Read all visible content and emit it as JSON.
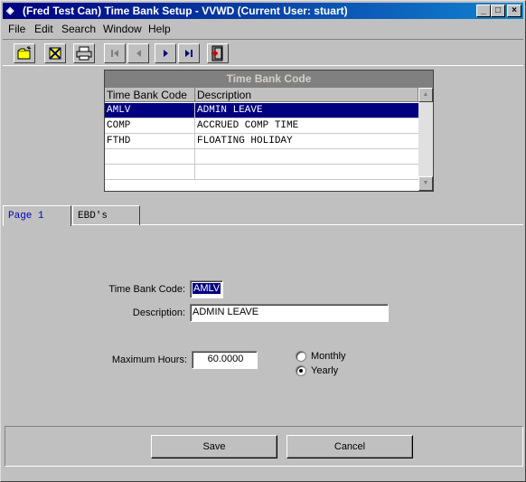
{
  "window": {
    "title": "(Fred Test Can) Time Bank Setup - VVWD (Current User: stuart)"
  },
  "menu": [
    "File",
    "Edit",
    "Search",
    "Window",
    "Help"
  ],
  "toolbar_icons": [
    "new-record-icon",
    "delete-record-icon",
    "print-icon",
    "first-record-icon",
    "previous-record-icon",
    "next-record-icon",
    "last-record-icon",
    "exit-icon"
  ],
  "grid": {
    "caption": "Time Bank Code",
    "columns": [
      "Time Bank Code",
      "Description"
    ],
    "rows": [
      {
        "code": "AMLV",
        "description": "ADMIN LEAVE"
      },
      {
        "code": "COMP",
        "description": "ACCRUED COMP TIME"
      },
      {
        "code": "FTHD",
        "description": "FLOATING HOLIDAY"
      }
    ]
  },
  "tabs": [
    "Page 1",
    "EBD's"
  ],
  "form": {
    "time_bank_code_label": "Time Bank Code:",
    "time_bank_code_value": "AMLV",
    "description_label": "Description:",
    "description_value": "ADMIN LEAVE",
    "max_hours_label": "Maximum Hours:",
    "max_hours_value": "60.0000",
    "period_options": [
      "Monthly",
      "Yearly"
    ],
    "period_selected": "Yearly"
  },
  "buttons": {
    "save": "Save",
    "cancel": "Cancel"
  },
  "colors": {
    "selection": "#000080",
    "title_bar": "#000080",
    "active_tab_text": "#0000c0"
  }
}
